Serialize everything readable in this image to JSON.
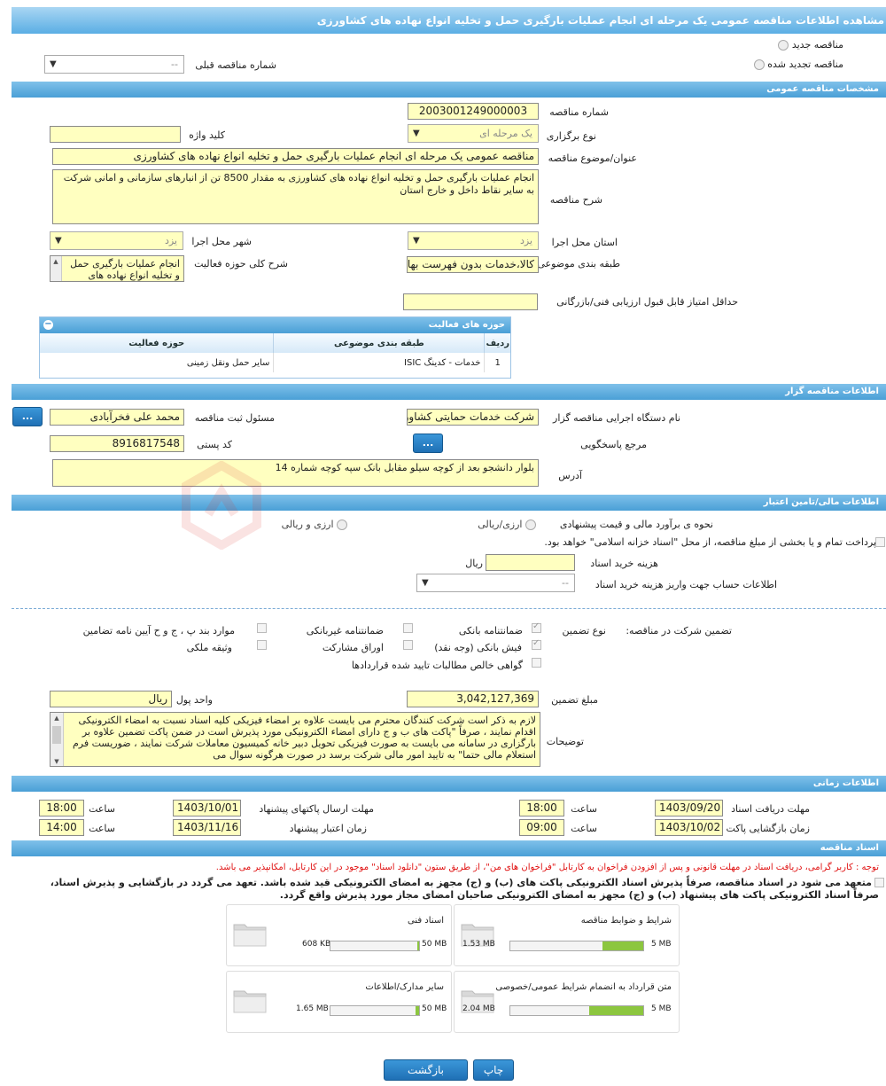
{
  "page_title": "مشاهده اطلاعات مناقصه عمومی یک مرحله ای انجام عملیات بارگیری حمل و تخلیه انواع نهاده های کشاورزی",
  "tender_type": {
    "new_label": "مناقصه جدید",
    "renewed_label": "مناقصه تجدید شده",
    "prev_number_label": "شماره مناقصه قبلی",
    "prev_number_value": "--"
  },
  "general": {
    "header": "مشخصات مناقصه عمومی",
    "number_label": "شماره مناقصه",
    "number_value": "2003001249000003",
    "holding_type_label": "نوع برگزاری",
    "holding_type_value": "یک مرحله ای",
    "keyword_label": "کلید واژه",
    "keyword_value": "",
    "subject_label": "عنوان/موضوع مناقصه",
    "subject_value": "مناقصه عمومی یک مرحله ای انجام عملیات بارگیری حمل و تخلیه انواع نهاده های کشاورزی",
    "description_label": "شرح مناقصه",
    "description_value": "انجام عملیات بارگیری حمل و تخلیه انواع نهاده های کشاورزی به مقدار 8500 تن از انبارهای سازمانی و امانی شرکت به سایر نقاط داخل و خارج استان",
    "province_label": "استان محل اجرا",
    "province_value": "یزد",
    "city_label": "شهر محل اجرا",
    "city_value": "یزد",
    "category_label": "طبقه بندی موضوعی",
    "category_value": "کالا،خدمات بدون فهرست بها",
    "activity_desc_label": "شرح کلی حوزه فعالیت",
    "activity_desc_value": "انجام عملیات بارگیری حمل و تخلیه انواع نهاده های",
    "min_score_label": "حداقل امتیاز قابل قبول ارزیابی فنی/بازرگانی",
    "min_score_value": ""
  },
  "activities": {
    "title": "حوزه های فعالیت",
    "headers": [
      "ردیف",
      "طبقه بندی موضوعی",
      "حوزه فعالیت"
    ],
    "rows": [
      {
        "index": "1",
        "category": "خدمات - کدینگ ISIC",
        "field": "سایر حمل ونقل زمینی"
      }
    ]
  },
  "organizer": {
    "header": "اطلاعات مناقصه گزار",
    "agency_label": "نام دستگاه اجرایی مناقصه گزار",
    "agency_value": "شرکت خدمات حمایتی کشاورزی",
    "registrar_label": "مسئول ثبت مناقصه",
    "registrar_value": "محمد علی فخرآبادی",
    "reference_label": "مرجع پاسخگویی",
    "postal_label": "کد پستی",
    "postal_value": "8916817548",
    "address_label": "آدرس",
    "address_value": "بلوار دانشجو بعد از کوچه سیلو مقابل بانک سپه کوچه شماره 14",
    "more_button": "..."
  },
  "finance": {
    "header": "اطلاعات مالی/تامین اعتبار",
    "estimate_label": "نحوه ی برآورد مالی و قیمت پیشنهادی",
    "opt_currency": "ارزی/ریالی",
    "opt_rial": "ارزی و ریالی",
    "treasury_text": "پرداخت تمام و یا بخشی از مبلغ مناقصه، از محل \"اسناد خزانه اسلامی\" خواهد بود.",
    "doc_cost_label": "هزینه خرید اسناد",
    "doc_cost_unit": "ریال",
    "doc_cost_value": "",
    "account_label": "اطلاعات حساب جهت واریز هزینه خرید اسناد",
    "account_value": "--"
  },
  "guarantee": {
    "participation_label": "تضمین شرکت در مناقصه:",
    "type_label": "نوع تضمین",
    "options": {
      "bank_guarantee": "ضمانتنامه بانکی",
      "non_bank_guarantee": "ضمانتنامه غیربانکی",
      "clauses": "موارد بند پ ، ج و ح آیین نامه تضامین",
      "bank_receipt": "فیش بانکی (وجه نقد)",
      "partnership_bonds": "اوراق مشارکت",
      "property_deed": "وثیقه ملکی",
      "net_claims": "گواهی خالص مطالبات تایید شده قراردادها"
    },
    "amount_label": "مبلغ تضمین",
    "amount_value": "3,042,127,369",
    "currency_label": "واحد پول",
    "currency_value": "ریال",
    "notes_label": "توضیحات",
    "notes_value": "لازم به ذکر است شرکت کنندگان محترم می بایست علاوه بر امضاء فیزیکی کلیه اسناد نسبت به امضاء الکترونیکی اقدام نمایند ، صرفاً \"پاکت های ب و ج دارای امضاء الکترونیکی مورد پذیرش است در ضمن پاکت تضمین علاوه بر بارگزاری در سامانه می بایست به صورت فیزیکی تحویل دبیر خانه کمیسیون معاملات شرکت نمایند ، ضوریست فرم استعلام مالی حتما\" به تایید امور مالی شرکت برسد در صورت هرگونه سوال می"
  },
  "timing": {
    "header": "اطلاعات زمانی",
    "doc_receive_label": "مهلت دریافت اسناد",
    "doc_receive_date": "1403/09/20",
    "doc_receive_time": "18:00",
    "send_deadline_label": "مهلت ارسال پاکتهای پیشنهاد",
    "send_deadline_date": "1403/10/01",
    "send_deadline_time": "18:00",
    "opening_label": "زمان بازگشایی پاکت ها",
    "opening_date": "1403/10/02",
    "opening_time": "09:00",
    "validity_label": "زمان اعتبار پیشنهاد",
    "validity_date": "1403/11/16",
    "validity_time": "14:00",
    "time_label": "ساعت"
  },
  "documents": {
    "header": "اسناد مناقصه",
    "notice": "توجه : کاربر گرامی، دریافت اسناد در مهلت قانونی و پس از افزودن فراخوان به کارتابل \"فراخوان های من\"، از طریق ستون \"دانلود اسناد\" موجود در این کارتابل، امکانپذیر می باشد.",
    "commit_line1": "متعهد می شود در اسناد مناقصه، صرفاً پذیرش اسناد الکترونیکی پاکت های (ب) و (ج) مجهز به امضای الکترونیکی قید شده باشد. تعهد می گردد در بازگشایی و پذیرش اسناد،",
    "commit_line2": "صرفاً اسناد الکترونیکی پاکت های پیشنهاد (ب) و (ج) مجهز به امضای الکترونیکی صاحبان امضای مجاز مورد پذیرش واقع گردد.",
    "files": [
      {
        "name": "شرایط و ضوابط مناقصه",
        "size": "1.53 MB",
        "max": "5 MB",
        "fill": 0.31
      },
      {
        "name": "اسناد فنی",
        "size": "608 KB",
        "max": "50 MB",
        "fill": 0.02
      },
      {
        "name": "متن قرارداد به انضمام شرایط عمومی/خصوصی",
        "size": "2.04 MB",
        "max": "5 MB",
        "fill": 0.41
      },
      {
        "name": "سایر مدارک/اطلاعات",
        "size": "1.65 MB",
        "max": "50 MB",
        "fill": 0.04
      }
    ]
  },
  "buttons": {
    "print": "چاپ",
    "back": "بازگشت"
  },
  "watermark": "AriaTender.neT"
}
